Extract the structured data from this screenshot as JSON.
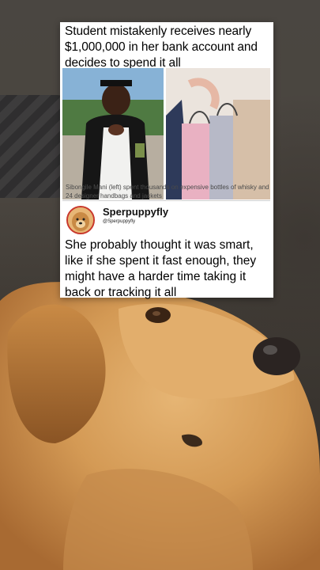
{
  "post": {
    "headline": "Student mistakenly receives nearly $1,000,000 in her bank account and decides to spend it all",
    "caption": "Sibongile Mani (left) spent thousands on expensive bottles of whisky and 24 designer handbags and jackets",
    "author": {
      "name": "Sperpuppyfly",
      "handle": "@Sperpuppyfly"
    },
    "text": "She probably thought it was smart, like if she spent it fast enough, they might have a harder time taking it back or tracking it all"
  },
  "colors": {
    "card_bg": "#ffffff",
    "dog_fur": "#d7a260",
    "background": "#4a453f"
  },
  "icons": [
    "avatar-dog-icon"
  ]
}
